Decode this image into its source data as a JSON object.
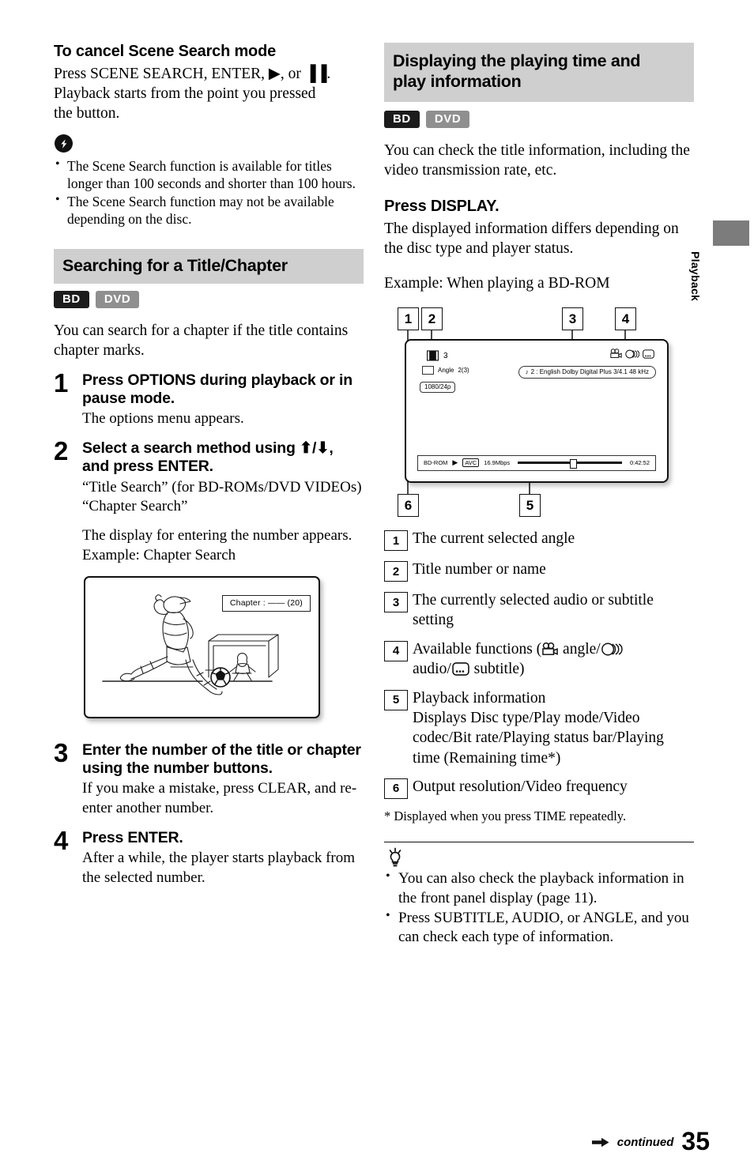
{
  "page": {
    "number": "35",
    "continued_label": "continued",
    "side_tab": "Playback"
  },
  "left_column": {
    "cancel_section": {
      "heading": "To cancel Scene Search mode",
      "body_line1": "Press SCENE SEARCH, ENTER, ▶, or ▐▐.",
      "body_line2": "Playback starts from the point you pressed",
      "body_line3": "the button.",
      "note_icon": "note-exclamation-icon",
      "notes": [
        "The Scene Search function is available for titles longer than 100 seconds and shorter than 100 hours.",
        "The Scene Search function may not be available depending on the disc."
      ]
    },
    "search_section": {
      "banner_title": "Searching for a Title/Chapter",
      "badges": [
        "BD",
        "DVD"
      ],
      "intro": "You can search for a chapter if the title contains chapter marks.",
      "steps": [
        {
          "num": "1",
          "head": "Press OPTIONS during playback or in pause mode.",
          "sub": "The options menu appears."
        },
        {
          "num": "2",
          "head": "Select a search method using ⬆/⬇, and press ENTER.",
          "sub": "“Title Search” (for BD-ROMs/DVD VIDEOs)",
          "sub2": "“Chapter Search”",
          "sub3": "The display for entering the number appears.",
          "sub4": "Example: Chapter Search"
        },
        {
          "num": "3",
          "head": "Enter the number of the title or chapter using the number buttons.",
          "sub": "If you make a mistake, press CLEAR, and re-enter another number."
        },
        {
          "num": "4",
          "head": "Press ENTER.",
          "sub": "After a while, the player starts playback from the selected number."
        }
      ],
      "illustration": {
        "name": "soccer-chapter-search-illustration",
        "chapter_overlay": "Chapter :  —— (20)"
      }
    }
  },
  "right_column": {
    "banner_title_line1": "Displaying the playing time and",
    "banner_title_line2": "play information",
    "badges": [
      "BD",
      "DVD"
    ],
    "intro": "You can check the title information, including the video transmission rate, etc.",
    "press_display_heading": "Press DISPLAY.",
    "press_display_body": "The displayed information differs depending on the disc type and player status.",
    "example_caption": "Example: When playing a BD-ROM",
    "osd": {
      "callouts_top": [
        "1",
        "2",
        "3",
        "4"
      ],
      "callouts_bottom": [
        "6",
        "5"
      ],
      "title_number": "3",
      "angle_label": "Angle",
      "angle_value": "2(3)",
      "resolution": "1080/24p",
      "audio_info": "2 : English  Dolby Digital Plus  3/4.1 48 kHz",
      "audio_note_glyph": "♪",
      "disc_type": "BD-ROM",
      "play_mode_glyph": "▶",
      "video_codec": "AVC",
      "bit_rate": "16.9Mbps",
      "playing_time": "0:42:52",
      "function_icons": [
        "angle-camera-icon",
        "audio-discs-icon",
        "subtitle-box-icon"
      ]
    },
    "definitions": [
      {
        "num": "1",
        "text": "The current selected angle"
      },
      {
        "num": "2",
        "text": "Title number or name"
      },
      {
        "num": "3",
        "text": "The currently selected audio or subtitle setting"
      },
      {
        "num": "4",
        "text_pre": "Available functions (",
        "text_mid": " angle/",
        "text_mid2": " audio/",
        "text_post": " subtitle)"
      },
      {
        "num": "5",
        "text": "Playback information",
        "text2": "Displays Disc type/Play mode/Video codec/Bit rate/Playing status bar/Playing time (Remaining time*)"
      },
      {
        "num": "6",
        "text": "Output resolution/Video frequency"
      }
    ],
    "footnote": "* Displayed when you press TIME repeatedly.",
    "tip_icon": "lightbulb-tip-icon",
    "tips": [
      "You can also check the playback information in the front panel display (page 11).",
      "Press SUBTITLE, AUDIO, or ANGLE, and you can check each type of information."
    ]
  }
}
